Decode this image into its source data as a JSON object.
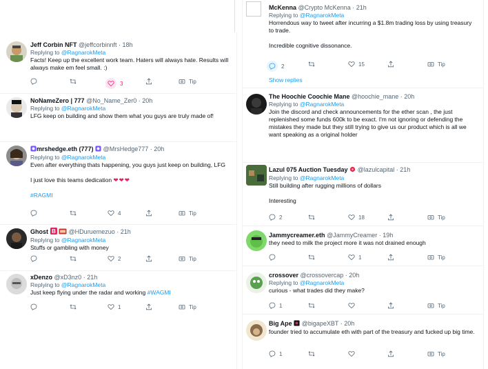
{
  "colors": {
    "accent": "#1d9bf0",
    "text": "#0f1419",
    "muted": "#536471",
    "like": "#f91880",
    "divider": "#eff3f4"
  },
  "left": [
    {
      "name": "Jeff Corbin NFT",
      "handle": "@jeffcorbinnft",
      "time": "18h",
      "replying_label": "Replying to",
      "mention": "@RagnarokMeta",
      "lines": [
        "Facts! Keep up the excellent work team. Haters will always hate. Results will always make em feel small. :)"
      ],
      "replies": "",
      "retweets": "",
      "likes": "3",
      "tip": "Tip",
      "liked": true
    },
    {
      "name": "NoNameZero | 777",
      "handle": "@No_Name_Zer0",
      "time": "20h",
      "replying_label": "Replying to",
      "mention": "@RagnarokMeta",
      "lines": [
        "LFG keep on building and show them what you guys are truly made of!"
      ],
      "replies": "",
      "retweets": "",
      "likes": "",
      "tip": "Tip"
    },
    {
      "name": "mrshedge.eth (777)",
      "handle": "@MrsHedge777",
      "time": "20h",
      "replying_label": "Replying to",
      "mention": "@RagnarokMeta",
      "line1": "Even after everything thats happening, you guys just keep on building, LFG",
      "line2": "I just love this teams dedication",
      "hearts": "❤❤❤",
      "hashtag": "#RAGMI",
      "replies": "",
      "retweets": "",
      "likes": "4",
      "tip": "Tip"
    },
    {
      "name": "Ghost",
      "handle": "@HDuruemezuo",
      "time": "21h",
      "replying_label": "Replying to",
      "mention": "@RagnarokMeta",
      "lines": [
        "Stuffs or gambling with money"
      ],
      "replies": "",
      "retweets": "",
      "likes": "2",
      "tip": "Tip"
    },
    {
      "name": "xDenzo",
      "handle": "@xD3nz0",
      "time": "21h",
      "replying_label": "Replying to",
      "mention": "@RagnarokMeta",
      "text_prefix": "Just keep flying under the radar and working ",
      "hashtag": "#WAGMI",
      "replies": "",
      "retweets": "",
      "likes": "1",
      "tip": "Tip"
    }
  ],
  "right": [
    {
      "name": "McKenna",
      "handle": "@Crypto McKenna",
      "time": "21h",
      "replying_label": "Replying to",
      "mention": "@RagnarokMeta",
      "line1": "Horrendous way to tweet after incurring a $1.8m trading loss by using treasury to trade.",
      "line2": "Incredible cognitive dissonance.",
      "replies": "2",
      "retweets": "",
      "likes": "15",
      "tip": "Tip",
      "show_replies": "Show replies"
    },
    {
      "name": "The Hoochie Coochie Mane",
      "handle": "@hoochie_mane",
      "time": "20h",
      "replying_label": "Replying to",
      "mention": "@RagnarokMeta",
      "lines": [
        "Join the discord and check announcements for the ether scan , the just replenished some funds 600k to be exact. I'm not ignoring or defending the mistakes they made but they still trying to give us our product which is all we want speaking as a original holder"
      ],
      "replies": "",
      "retweets": "",
      "likes": "",
      "tip": ""
    },
    {
      "name": "Lazul 075 Auction Tuesday",
      "handle": "@lazulcapital",
      "time": "21h",
      "replying_label": "Replying to",
      "mention": "@RagnarokMeta",
      "line1": "Still building after rugging millions of dollars",
      "line2": "Interesting",
      "replies": "2",
      "retweets": "",
      "likes": "18",
      "tip": "Tip"
    },
    {
      "name": "Jammycreamer.eth",
      "handle": "@JammyCreamer",
      "time": "19h",
      "lines": [
        "they need to milk the project more it was not drained enough"
      ],
      "replies": "",
      "retweets": "",
      "likes": "1",
      "tip": "Tip"
    },
    {
      "name": "crossover",
      "handle": "@crossovercap",
      "time": "20h",
      "replying_label": "Replying to",
      "mention": "@RagnarokMeta",
      "lines": [
        "curious - what trades did they make?"
      ],
      "replies": "1",
      "retweets": "",
      "likes": "",
      "tip": "Tip"
    },
    {
      "name": "Big Ape",
      "handle": "@bigapeXBT",
      "time": "20h",
      "lines": [
        "founder tried to accumulate eth with part of the treasury and fucked up big time."
      ],
      "replies": "1",
      "retweets": "",
      "likes": "",
      "tip": "Tip"
    }
  ]
}
